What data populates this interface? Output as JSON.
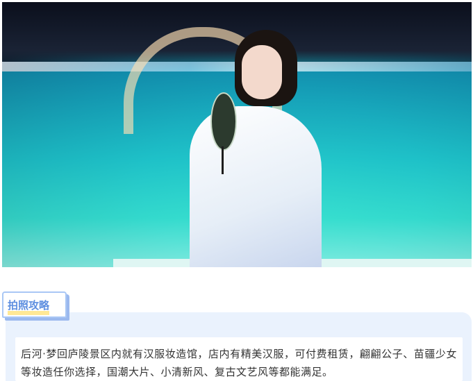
{
  "section": {
    "label": "拍照攻略",
    "description": "后河·梦回庐陵景区内就有汉服妆造馆，店内有精美汉服，可付费租赁，翩翩公子、苗疆少女等妆造任你选择，国潮大片、小清新风、复古文艺风等都能满足。"
  },
  "colors": {
    "label_text": "#5e8fe0",
    "label_border": "#a9c7f5",
    "label_highlight": "#ffe27a",
    "panel_bg": "#eaf2fd",
    "body_text": "#333333"
  }
}
